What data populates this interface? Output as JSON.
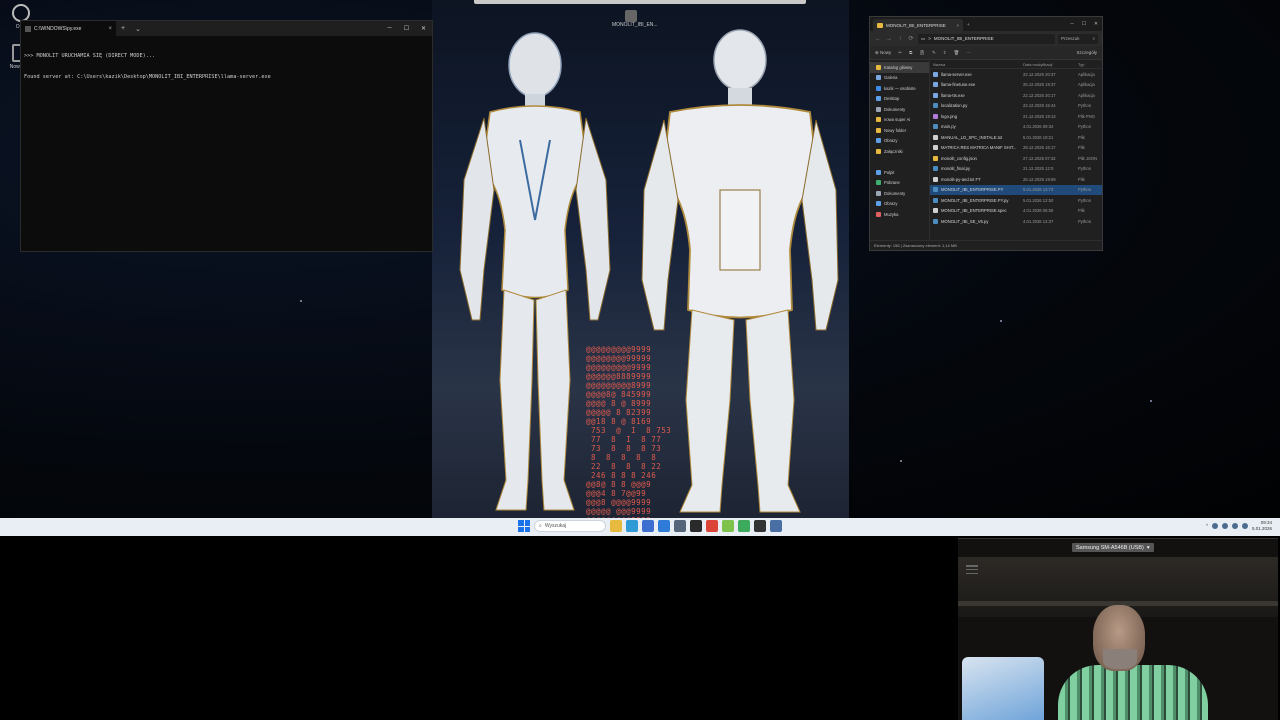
{
  "terminal": {
    "tab_title": "C:\\WINDOWS\\py.exe",
    "new_tab_glyph": "+",
    "dropdown_glyph": "⌄",
    "lines": [
      ">>> MONOLIT URUCHAMIA SIĘ (DIRECT MODE)...",
      "Found server at: C:\\Users\\kazik\\Desktop\\MONOLIT_IBI_ENTERPRISE\\llama-server.exe"
    ]
  },
  "desktop": {
    "icon_labels": [
      "OBS",
      "Nowy W..."
    ],
    "art_icon_label": "MONOLIT_IBI_EN..."
  },
  "wallpaper": {
    "matrix_lines": [
      "@@@@@@@@@9999",
      "@@@@@@@@99999",
      "@@@@@@@@@9999",
      "@@@@@@8889999",
      "@@@@@@@@@8999",
      "@@@@8@ 845999",
      "@@@@ 8 @ 8999",
      "@@@@@ 8 82399",
      "@@18 8 @ 8169",
      " 753  @  I  8 753",
      " 77  8  I  8 77",
      " 73  8  8  8 73",
      " 8  8  8  8  8",
      " 22  8  8  8 22",
      " 246 8 8 8 246",
      "@@8@ 8 8 @@@9",
      "@@@4 8 7@@99",
      "@@@8 @@@@9999",
      "@@@@@ @@@9999",
      "@@@@@@@@@9999",
      "@@@@@@@@99999",
      "@@@@@@@@@9999",
      "@@@@@@@@@9999"
    ]
  },
  "explorer": {
    "tab_title": "MONOLIT_IBI_ENTERPRISE",
    "path": "MONOLIT_IBI_ENTERPRISE",
    "path_sep": ">",
    "search_placeholder": "Przeszuk",
    "cmd_new": "Nowy",
    "cmd_more": "···",
    "cmd_details": "Szczegóły",
    "nav": [
      {
        "label": "Katalog główny",
        "color": "#e6b93f",
        "active": true
      },
      {
        "label": "Galeria",
        "color": "#7aa7e0",
        "active": false
      },
      {
        "label": "kazik — osobiste",
        "color": "#3f8ce6",
        "active": false
      },
      {
        "label": "Desktop",
        "color": "#5ba0e8",
        "active": false
      },
      {
        "label": "Dokumenty",
        "color": "#9aa6b4",
        "active": false
      },
      {
        "label": "nowa super Ai",
        "color": "#e6b93f",
        "active": false
      },
      {
        "label": "Nowy folder",
        "color": "#e6b93f",
        "active": false
      },
      {
        "label": "Obrazy",
        "color": "#5ba0e8",
        "active": false
      },
      {
        "label": "Załączniki",
        "color": "#e6b93f",
        "active": false
      },
      {
        "label": "",
        "color": "transparent",
        "active": false
      },
      {
        "label": "Pulpit",
        "color": "#5ba0e8",
        "active": false
      },
      {
        "label": "Pobrane",
        "color": "#3fb06b",
        "active": false
      },
      {
        "label": "Dokumenty",
        "color": "#9aa6b4",
        "active": false
      },
      {
        "label": "Obrazy",
        "color": "#5ba0e8",
        "active": false
      },
      {
        "label": "Muzyka",
        "color": "#e06060",
        "active": false
      }
    ],
    "columns": {
      "name": "Nazwa",
      "date": "Data modyfikacji",
      "type": "Typ"
    },
    "files": [
      {
        "name": "llama-server.exe",
        "date": "22.12.2025 20:37",
        "type": "Aplikacja",
        "color": "#7aa7e0",
        "selected": false
      },
      {
        "name": "llama-finetune.exe",
        "date": "25.12.2025 19:37",
        "type": "Aplikacja",
        "color": "#7aa7e0",
        "selected": false
      },
      {
        "name": "llama-tts.exe",
        "date": "22.12.2025 20:17",
        "type": "Aplikacja",
        "color": "#7aa7e0",
        "selected": false
      },
      {
        "name": "localization.py",
        "date": "22.12.2025 15:44",
        "type": "Python",
        "color": "#4b8bbe",
        "selected": false
      },
      {
        "name": "logo.png",
        "date": "21.12.2025 19:13",
        "type": "Plik PNG",
        "color": "#b07ad9",
        "selected": false
      },
      {
        "name": "main.py",
        "date": "4.01.2026 09:34",
        "type": "Python",
        "color": "#4b8bbe",
        "selected": false
      },
      {
        "name": "MANUAL_LD_SPC_INSTALE.txt",
        "date": "5.01.2026 10:21",
        "type": "Plik",
        "color": "#cfcfcf",
        "selected": false
      },
      {
        "name": "MATRICA RES MATRICA MANIF SHIT...",
        "date": "28.12.2025 16:17",
        "type": "Plik",
        "color": "#cfcfcf",
        "selected": false
      },
      {
        "name": "monolit_config.json",
        "date": "27.12.2025 07:32",
        "type": "Plik JSON",
        "color": "#e6b93f",
        "selected": false
      },
      {
        "name": "monolit_final.py",
        "date": "21.12.2025 12:0",
        "type": "Python",
        "color": "#4b8bbe",
        "selected": false
      },
      {
        "name": "monolit-py-and.txt FT",
        "date": "25.12.2025 19:59",
        "type": "Plik",
        "color": "#cfcfcf",
        "selected": false
      },
      {
        "name": "MONOLIT_IBI_ENTERPRISE.PY",
        "date": "5.01.2026 13:73",
        "type": "Python",
        "color": "#4b8bbe",
        "selected": true
      },
      {
        "name": "MONOLIT_IBI_ENTERPRISE.PY.py",
        "date": "5.01.2026 12:50",
        "type": "Python",
        "color": "#4b8bbe",
        "selected": false
      },
      {
        "name": "MONOLIT_IBI_ENTERPRISE.spec",
        "date": "4.01.2026 08:55",
        "type": "Plik",
        "color": "#cfcfcf",
        "selected": false
      },
      {
        "name": "MONOLIT_IBI_SE_V6.py",
        "date": "4.01.2026 12:37",
        "type": "Python",
        "color": "#4b8bbe",
        "selected": false
      }
    ],
    "status": "Elementy: 156 | Zaznaczony element: 1,14 MB"
  },
  "taskbar": {
    "search_label": "Wyszukaj",
    "pinned": [
      {
        "name": "file-explorer-icon",
        "color": "#e6b93f"
      },
      {
        "name": "edge-icon",
        "color": "#2e9ad6"
      },
      {
        "name": "store-icon",
        "color": "#3d6fd1"
      },
      {
        "name": "app-blue-icon",
        "color": "#2f7bd8"
      },
      {
        "name": "settings-icon",
        "color": "#55657a"
      },
      {
        "name": "obs-icon",
        "color": "#2a2a2a"
      },
      {
        "name": "chrome-icon",
        "color": "#db4437"
      },
      {
        "name": "notepad-icon",
        "color": "#7dc24b"
      },
      {
        "name": "app-green-icon",
        "color": "#3caa5c"
      },
      {
        "name": "terminal-icon",
        "color": "#333"
      },
      {
        "name": "app-grid-icon",
        "color": "#4a6fa5"
      }
    ],
    "tray_up": "^",
    "clock_time": "09:34",
    "clock_date": "5.01.2026"
  },
  "webcam": {
    "label": "Samsung SM-A546B (USB)"
  },
  "colors": {
    "taskbar_bg": "#e9eef4",
    "selection": "#1f4a7a",
    "terminal_bg": "#0c0c0c",
    "matrix_text": "#e05a4c"
  }
}
